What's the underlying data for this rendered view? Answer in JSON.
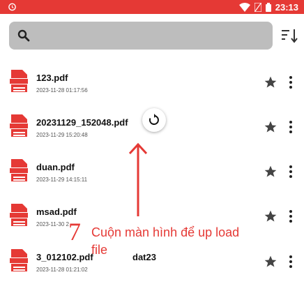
{
  "status": {
    "time": "23:13"
  },
  "search": {
    "placeholder": ""
  },
  "files": [
    {
      "name": "123.pdf",
      "date": "2023-11-28 01:17:56"
    },
    {
      "name": "20231129_152048.pdf",
      "date": "2023-11-29 15:20:48"
    },
    {
      "name": "duan.pdf",
      "date": "2023-11-29 14:15:11"
    },
    {
      "name": "msad.pdf",
      "date": "2023-11-30 2"
    },
    {
      "name": "3_012102.pdf",
      "date": "2023-11-28 01:21:02"
    }
  ],
  "overlay_text": "dat23",
  "annotation": {
    "number": "7",
    "text": "Cuộn màn hình để up load file"
  },
  "colors": {
    "status_bar": "#e53935",
    "pdf_red": "#e53935",
    "annotation": "#e53935",
    "search_bg": "#bdbdbd"
  },
  "icons": [
    "alarm-icon",
    "wifi-icon",
    "battery-icon",
    "search-icon",
    "sort-icon",
    "pdf-file-icon",
    "star-icon",
    "more-vert-icon",
    "refresh-icon"
  ]
}
